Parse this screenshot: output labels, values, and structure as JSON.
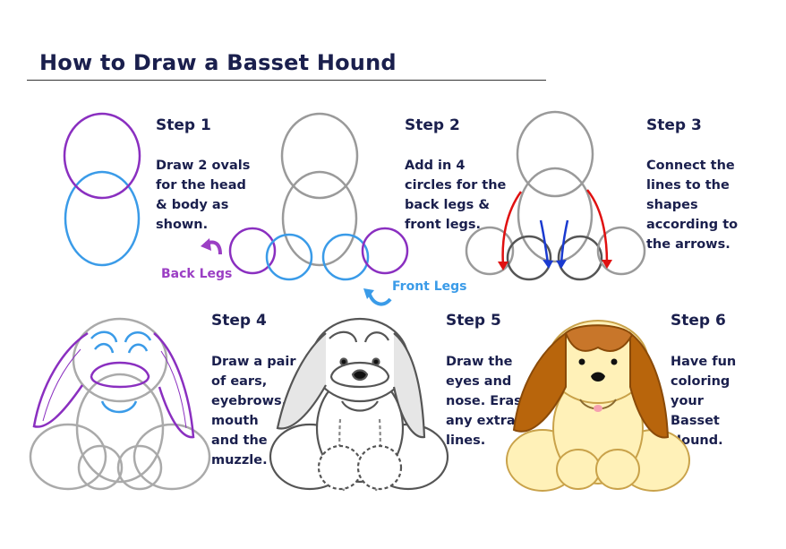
{
  "title": "How to Draw a Basset Hound",
  "steps": [
    {
      "heading": "Step 1",
      "text": "Draw 2 ovals\nfor the head\n& body as\nshown."
    },
    {
      "heading": "Step 2",
      "text": "Add in 4\ncircles for the\nback legs &\nfront legs."
    },
    {
      "heading": "Step 3",
      "text": "Connect the\nlines to the\nshapes\naccording to\nthe arrows."
    },
    {
      "heading": "Step 4",
      "text": "Draw a pair\nof ears,\neyebrows,\nmouth\nand the\nmuzzle."
    },
    {
      "heading": "Step 5",
      "text": "Draw the\neyes and\nnose. Erase\nany extra\nlines."
    },
    {
      "heading": "Step 6",
      "text": "Have fun\ncoloring\nyour\n Basset\n  Hound."
    }
  ],
  "labels": {
    "back_legs": "Back Legs",
    "front_legs": "Front Legs"
  },
  "colors": {
    "title": "#1a1f4d",
    "head_oval": "#8a2fc0",
    "body_oval": "#3a9be8",
    "guide_gray": "#9a9a9a",
    "arrow_red": "#e01010",
    "arrow_blue": "#1a3ad0",
    "back_legs_label": "#9b3fc4",
    "front_legs_label": "#3a9be8",
    "ear_brown": "#b8650c",
    "fur_cream": "#fff1b8"
  }
}
